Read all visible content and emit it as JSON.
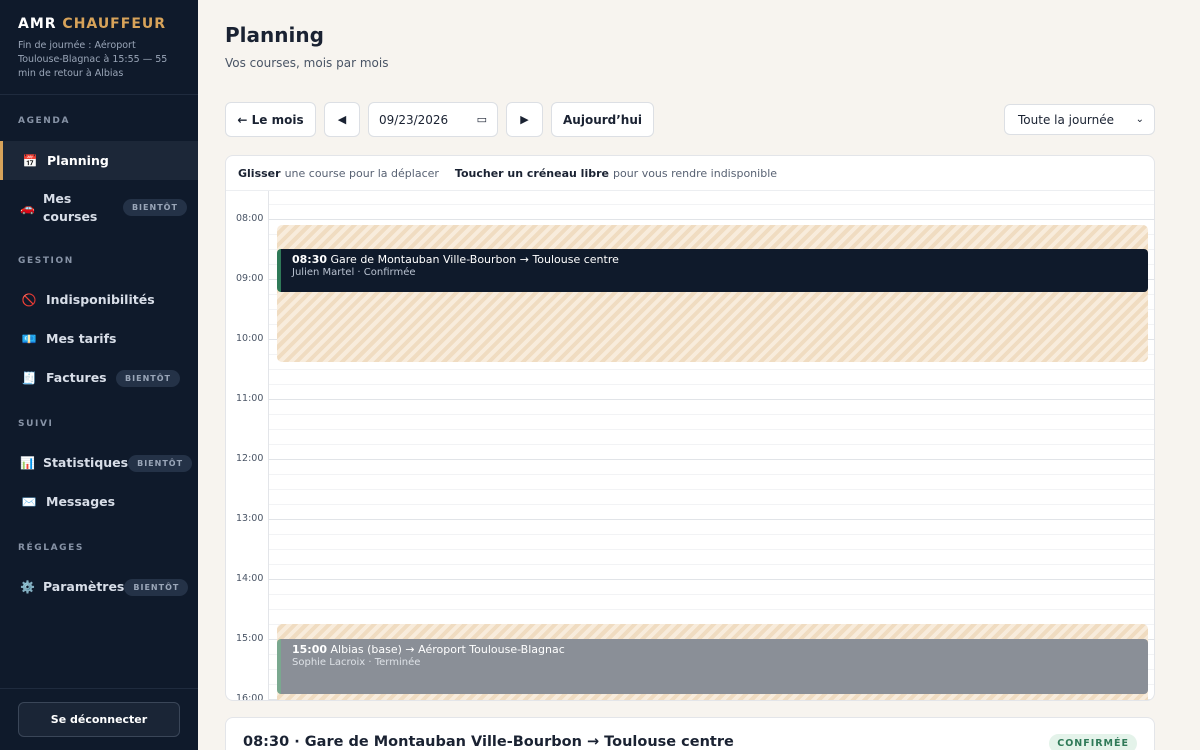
{
  "brand": {
    "name_part1": "AMR",
    "name_part2": "CHAUFFEUR",
    "subtitle": "Fin de journée : Aéroport Toulouse-Blagnac à 15:55 — 55 min de retour à Albias"
  },
  "sidebar": {
    "sections": {
      "agenda": "AGENDA",
      "gestion": "GESTION",
      "suivi": "SUIVI",
      "reglages": "RÉGLAGES"
    },
    "items": [
      {
        "label": "Planning",
        "icon": "📅",
        "badge": ""
      },
      {
        "label": "Mes courses",
        "icon": "🚗",
        "badge": "BIENTÔT"
      },
      {
        "label": "Indisponibilités",
        "icon": "🚫",
        "badge": ""
      },
      {
        "label": "Mes tarifs",
        "icon": "💶",
        "badge": ""
      },
      {
        "label": "Factures",
        "icon": "🧾",
        "badge": "BIENTÔT"
      },
      {
        "label": "Statistiques",
        "icon": "📊",
        "badge": "BIENTÔT"
      },
      {
        "label": "Messages",
        "icon": "✉️",
        "badge": ""
      },
      {
        "label": "Paramètres",
        "icon": "⚙️",
        "badge": "BIENTÔT"
      }
    ],
    "logout_label": "Se déconnecter"
  },
  "header": {
    "title": "Planning",
    "subtitle": "Vos courses, mois par mois"
  },
  "toolbar": {
    "back_label": "← Le mois",
    "prev_label": "◀",
    "date_value": "09/23/2026",
    "next_label": "▶",
    "today_label": "Aujourd’hui",
    "filter_value": "Toute la journée"
  },
  "calendar": {
    "hint_drag_bold": "Glisser",
    "hint_drag_text": "une course pour la déplacer",
    "hint_tap_bold": "Toucher un créneau libre",
    "hint_tap_text": "pour vous rendre indisponible",
    "hours": [
      "08:00",
      "09:00",
      "10:00",
      "11:00",
      "12:00",
      "13:00",
      "14:00",
      "15:00",
      "16:00"
    ],
    "events": [
      {
        "time": "08:30",
        "route": "Gare de Montauban Ville-Bourbon → Toulouse centre",
        "client": "Julien Martel",
        "status": "Confirmée"
      },
      {
        "time": "15:00",
        "route": "Albias (base) → Aéroport Toulouse-Blagnac",
        "client": "Sophie Lacroix",
        "status": "Terminée"
      }
    ]
  },
  "detail": {
    "title": "08:30 · Gare de Montauban Ville-Bourbon → Toulouse centre",
    "status": "CONFIRMÉE"
  }
}
